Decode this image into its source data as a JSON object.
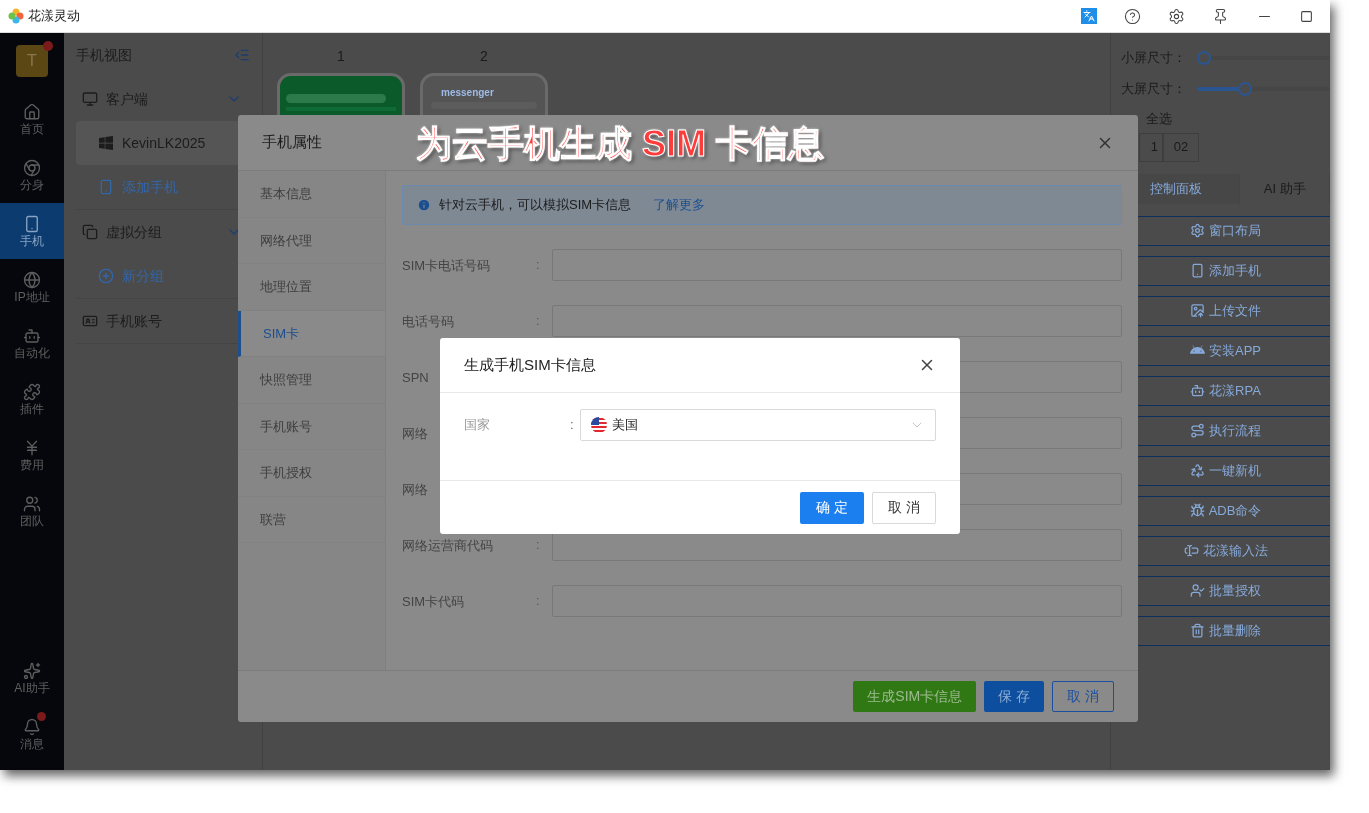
{
  "window": {
    "title": "花漾灵动"
  },
  "nav": {
    "avatar": "T",
    "avatar_badge": true,
    "items": [
      {
        "label": "首页",
        "selected": false,
        "badge": false
      },
      {
        "label": "分身",
        "selected": false,
        "badge": false
      },
      {
        "label": "手机",
        "selected": true,
        "badge": false
      },
      {
        "label": "IP地址",
        "selected": false,
        "badge": false
      },
      {
        "label": "自动化",
        "selected": false,
        "badge": false
      },
      {
        "label": "插件",
        "selected": false,
        "badge": false
      },
      {
        "label": "费用",
        "selected": false,
        "badge": false
      },
      {
        "label": "团队",
        "selected": false,
        "badge": false
      }
    ],
    "bottom_items": [
      {
        "label": "AI助手",
        "selected": false,
        "badge": false
      },
      {
        "label": "消息",
        "selected": false,
        "badge": true
      }
    ]
  },
  "panel": {
    "title": "手机视图",
    "tree": [
      {
        "label": "客户端",
        "kind": "group",
        "expanded": true,
        "children": [
          {
            "label": "KevinLK2025",
            "kind": "item",
            "selected": true
          },
          {
            "label": "添加手机",
            "kind": "action",
            "selected": false
          }
        ]
      },
      {
        "label": "虚拟分组",
        "kind": "group",
        "expanded": true,
        "children": [
          {
            "label": "新分组",
            "kind": "action",
            "selected": false
          }
        ]
      },
      {
        "label": "手机账号",
        "kind": "leaf"
      }
    ]
  },
  "phones": [
    {
      "number": "1",
      "kind": "store"
    },
    {
      "number": "2",
      "kind": "messenger",
      "app_title": "messenger"
    }
  ],
  "right": {
    "sliders": [
      {
        "label": "小屏尺寸：",
        "level": 0.05
      },
      {
        "label": "大屏尺寸：",
        "level": 0.36
      }
    ],
    "select_all": "全选",
    "chips": [
      "1",
      "02"
    ],
    "tabs": [
      {
        "label": "控制面板",
        "selected": true
      },
      {
        "label": "AI 助手",
        "selected": false
      }
    ],
    "actions": [
      "窗口布局",
      "添加手机",
      "上传文件",
      "安装APP",
      "花漾RPA",
      "执行流程",
      "一键新机",
      "ADB命令",
      "花漾输入法",
      "批量授权",
      "批量删除"
    ]
  },
  "modal": {
    "title": "手机属性",
    "tabs": [
      {
        "label": "基本信息",
        "selected": false
      },
      {
        "label": "网络代理",
        "selected": false
      },
      {
        "label": "地理位置",
        "selected": false
      },
      {
        "label": "SIM卡",
        "selected": true
      },
      {
        "label": "快照管理",
        "selected": false
      },
      {
        "label": "手机账号",
        "selected": false
      },
      {
        "label": "手机授权",
        "selected": false
      },
      {
        "label": "联营",
        "selected": false
      }
    ],
    "notice": {
      "text": "针对云手机，可以模拟SIM卡信息",
      "link": "了解更多"
    },
    "fields": [
      {
        "label": "SIM卡电话号码",
        "colon": ":"
      },
      {
        "label": "电话号码",
        "colon": ":"
      },
      {
        "label": "SPN"
      },
      {
        "label": "网络"
      },
      {
        "label": "网络"
      },
      {
        "label": "网络运营商代码",
        "colon": ":"
      },
      {
        "label": "SIM卡代码",
        "colon": ":"
      }
    ],
    "buttons": [
      {
        "label": "生成SIM卡信息",
        "kind": "success"
      },
      {
        "label": "保 存",
        "kind": "primary"
      },
      {
        "label": "取 消",
        "kind": "outline"
      }
    ]
  },
  "dialog": {
    "title": "生成手机SIM卡信息",
    "field": {
      "label": "国家",
      "colon": ":",
      "value": "美国"
    },
    "buttons": [
      {
        "label": "确 定",
        "kind": "primary"
      },
      {
        "label": "取 消",
        "kind": "default"
      }
    ]
  },
  "annotation": "为云手机生成 SIM 卡信息"
}
